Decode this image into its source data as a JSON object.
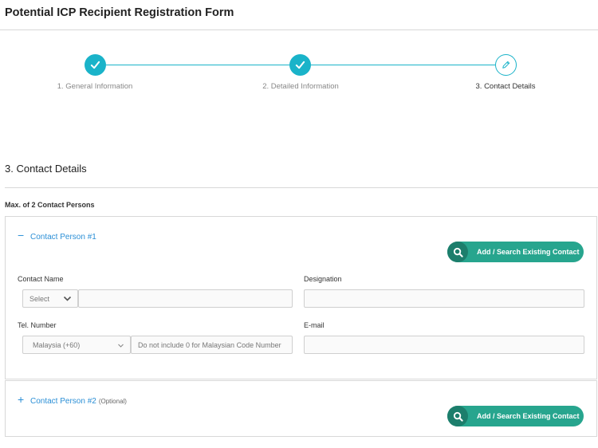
{
  "page": {
    "title": "Potential ICP Recipient Registration Form"
  },
  "stepper": {
    "steps": [
      {
        "label": "1. General Information",
        "state": "complete"
      },
      {
        "label": "2. Detailed Information",
        "state": "complete"
      },
      {
        "label": "3. Contact Details",
        "state": "current"
      }
    ],
    "accent_color": "#1ab3c9"
  },
  "section": {
    "title": "3. Contact Details",
    "max_note": "Max. of 2 Contact Persons"
  },
  "contact1": {
    "header": "Contact Person #1",
    "toggle_icon": "minus-icon",
    "add_button": "Add / Search Existing Contact",
    "name_label": "Contact Name",
    "salutation_value": "Select",
    "name_value": "",
    "designation_label": "Designation",
    "designation_value": "",
    "tel_label": "Tel. Number",
    "country_value": "Malaysia (+60)",
    "tel_placeholder": "Do not include 0 for Malaysian Code Number",
    "email_label": "E-mail",
    "email_value": ""
  },
  "contact2": {
    "header": "Contact Person #2",
    "optional": "(Optional)",
    "toggle_icon": "plus-icon",
    "add_button": "Add / Search Existing Contact"
  },
  "colors": {
    "button": "#27a58e",
    "link": "#2b8fd6"
  }
}
